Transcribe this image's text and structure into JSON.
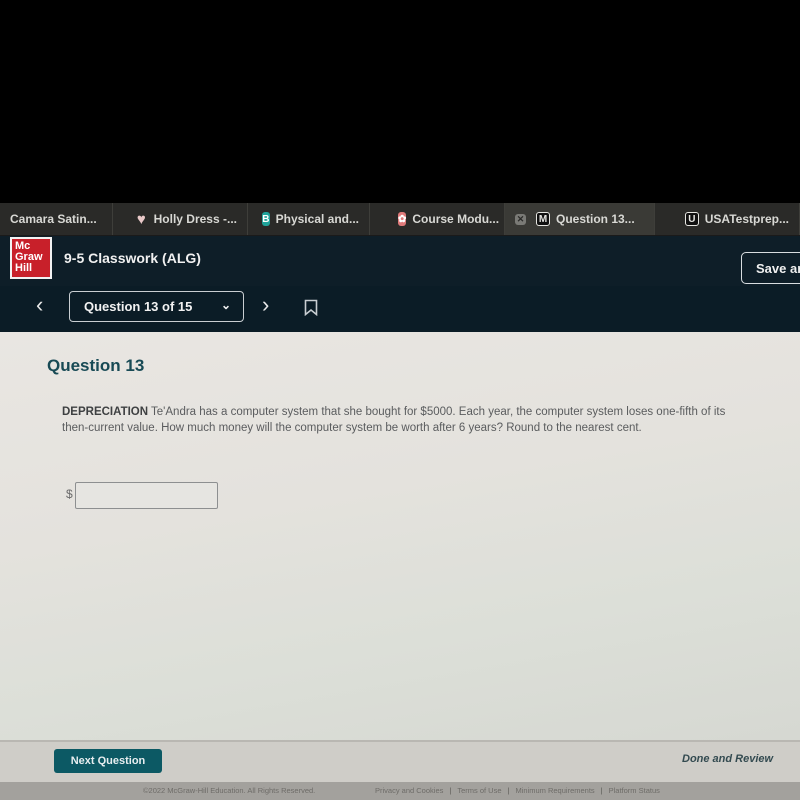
{
  "browser": {
    "tabs": [
      {
        "label": "Camara Satin...",
        "icon": "none"
      },
      {
        "label": "Holly Dress -...",
        "icon": "heart-icon"
      },
      {
        "label": "Physical and...",
        "icon": "b-favicon",
        "icon_glyph": "B"
      },
      {
        "label": "Course Modu...",
        "icon": "course-favicon",
        "icon_glyph": "✿"
      },
      {
        "label": "Question 13...",
        "icon": "m-favicon",
        "icon_glyph": "M",
        "active": true,
        "close_glyph": "✕"
      },
      {
        "label": "USATestprep...",
        "icon": "u-favicon",
        "icon_glyph": "U"
      }
    ]
  },
  "header": {
    "logo_lines": [
      "Mc",
      "Graw",
      "Hill"
    ],
    "assignment_title": "9-5 Classwork (ALG)",
    "save_button": "Save ar",
    "brand_color": "#c8202a"
  },
  "nav": {
    "prev_glyph": "‹",
    "next_glyph": "›",
    "question_selector": "Question 13 of 15",
    "chevron_glyph": "⌄"
  },
  "question": {
    "heading": "Question 13",
    "keyword": "DEPRECIATION",
    "body": " Te'Andra has a computer system that she bought for $5000. Each year, the computer system loses one-fifth of its then-current value. How much money will the computer system be worth after 6 years? Round to the nearest cent.",
    "currency_symbol": "$",
    "answer_value": "",
    "answer_placeholder": ""
  },
  "actions": {
    "next_button": "Next Question",
    "done_link": "Done and Review",
    "accent_color": "#0c5964"
  },
  "footer": {
    "copyright": "©2022 McGraw-Hill Education. All Rights Reserved.",
    "links": [
      "Privacy and Cookies",
      "Terms of Use",
      "Minimum Requirements",
      "Platform Status"
    ],
    "separator": "|"
  }
}
